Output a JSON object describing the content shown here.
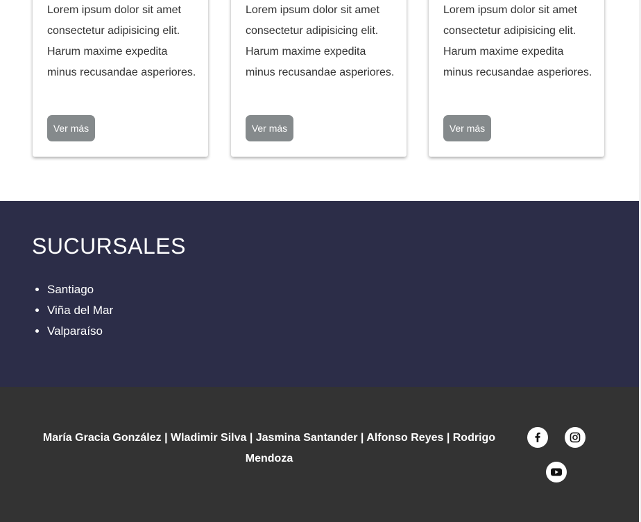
{
  "cards": [
    {
      "text": "Lorem ipsum dolor sit amet consectetur adipisicing elit. Harum maxime expedita minus recusandae asperiores.",
      "button_label": "Ver más"
    },
    {
      "text": "Lorem ipsum dolor sit amet consectetur adipisicing elit. Harum maxime expedita minus recusandae asperiores.",
      "button_label": "Ver más"
    },
    {
      "text": "Lorem ipsum dolor sit amet consectetur adipisicing elit. Harum maxime expedita minus recusandae asperiores.",
      "button_label": "Ver más"
    }
  ],
  "branches": {
    "title": "SUCURSALES",
    "items": [
      "Santiago",
      "Viña del Mar",
      "Valparaíso"
    ]
  },
  "footer": {
    "credits": "María Gracia González | Wladimir Silva | Jasmina Santander | Alfonso Reyes | Rodrigo Mendoza",
    "social": [
      {
        "icon": "facebook-icon"
      },
      {
        "icon": "instagram-icon"
      },
      {
        "icon": "youtube-icon"
      }
    ]
  },
  "colors": {
    "button": "#858a8c",
    "branches_bg": "#2c2d48",
    "footer_bg": "#333333"
  }
}
